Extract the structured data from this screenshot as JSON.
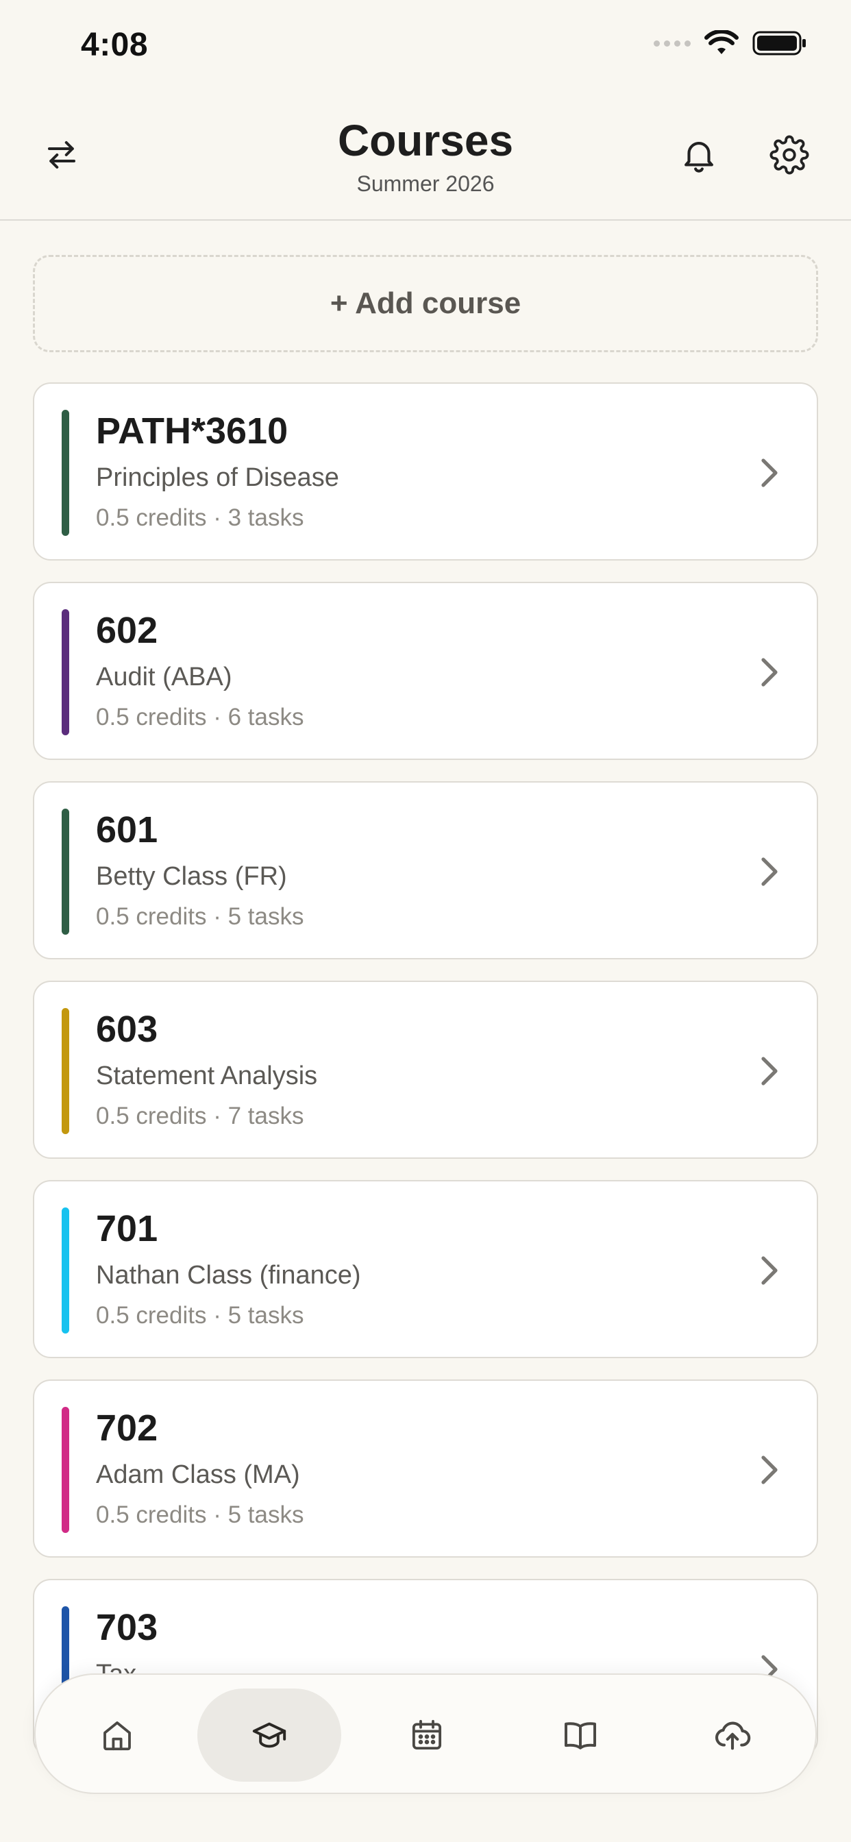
{
  "status_bar": {
    "time": "4:08"
  },
  "header": {
    "title": "Courses",
    "subtitle": "Summer 2026",
    "left_icon": "swap-arrows-icon",
    "right_icons": [
      "bell-icon",
      "gear-icon"
    ]
  },
  "add_course": {
    "label": "+ Add course"
  },
  "courses": [
    {
      "code": "PATH*3610",
      "name": "Principles of Disease",
      "meta": "0.5 credits · 3 tasks",
      "color": "#2f5e45"
    },
    {
      "code": "602",
      "name": "Audit (ABA)",
      "meta": "0.5 credits · 6 tasks",
      "color": "#5b2d7c"
    },
    {
      "code": "601",
      "name": "Betty Class (FR)",
      "meta": "0.5 credits · 5 tasks",
      "color": "#2f5e45"
    },
    {
      "code": "603",
      "name": "Statement Analysis",
      "meta": "0.5 credits · 7 tasks",
      "color": "#c3980e"
    },
    {
      "code": "701",
      "name": "Nathan Class (finance)",
      "meta": "0.5 credits · 5 tasks",
      "color": "#17c2ef"
    },
    {
      "code": "702",
      "name": "Adam Class (MA)",
      "meta": "0.5 credits · 5 tasks",
      "color": "#d12a86"
    },
    {
      "code": "703",
      "name": "Tax",
      "meta": "",
      "color": "#1e55a8"
    }
  ],
  "bottom_nav": {
    "items": [
      {
        "icon": "home-icon",
        "active": false
      },
      {
        "icon": "graduation-cap-icon",
        "active": true
      },
      {
        "icon": "calendar-icon",
        "active": false
      },
      {
        "icon": "book-icon",
        "active": false
      },
      {
        "icon": "cloud-upload-icon",
        "active": false
      }
    ]
  }
}
